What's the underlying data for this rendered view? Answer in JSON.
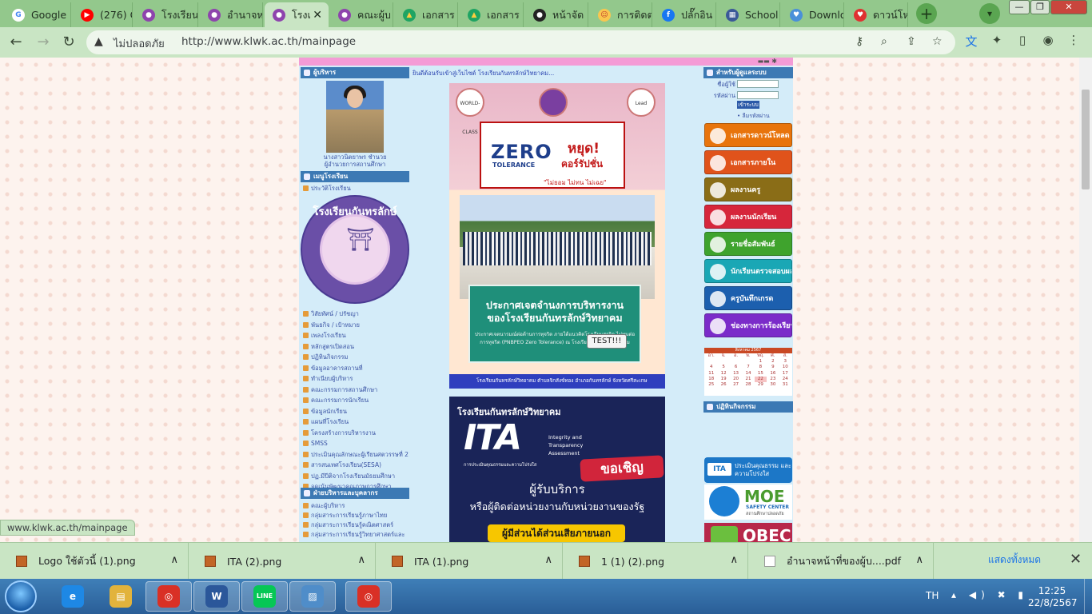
{
  "browser": {
    "tabs": [
      {
        "title": "Google",
        "color": "#ffffff",
        "glyph": "G",
        "glyph_color": "#4285f4"
      },
      {
        "title": "(276) G",
        "color": "#ff0000",
        "glyph": "▶",
        "glyph_color": "#ffffff"
      },
      {
        "title": "โรงเรียน",
        "color": "#8e44ad",
        "glyph": "●",
        "glyph_color": "#ffffff"
      },
      {
        "title": "อำนาจห",
        "color": "#8e44ad",
        "glyph": "●",
        "glyph_color": "#ffffff"
      },
      {
        "title": "โรงเ",
        "color": "#8e44ad",
        "glyph": "●",
        "glyph_color": "#ffffff",
        "active": true
      },
      {
        "title": "คณะผู้บ",
        "color": "#8e44ad",
        "glyph": "●",
        "glyph_color": "#ffffff"
      },
      {
        "title": "เอกสาร",
        "color": "#1fa463",
        "glyph": "▲",
        "glyph_color": "#ffcd40"
      },
      {
        "title": "เอกสาร",
        "color": "#1fa463",
        "glyph": "▲",
        "glyph_color": "#ffcd40"
      },
      {
        "title": "หน้าจัด",
        "color": "#222222",
        "glyph": "●",
        "glyph_color": "#ffffff"
      },
      {
        "title": "การติดต่",
        "color": "#f9c74f",
        "glyph": "☺",
        "glyph_color": "#c0392b"
      },
      {
        "title": "ปลั๊กอิน",
        "color": "#1877f2",
        "glyph": "f",
        "glyph_color": "#ffffff"
      },
      {
        "title": "School",
        "color": "#3b5998",
        "glyph": "▦",
        "glyph_color": "#ffffff"
      },
      {
        "title": "Downlo",
        "color": "#4a90d9",
        "glyph": "♥",
        "glyph_color": "#ffffff"
      },
      {
        "title": "ดาวน์โห",
        "color": "#e03131",
        "glyph": "♥",
        "glyph_color": "#ffffff"
      }
    ],
    "tab_close_glyph": "✕",
    "new_tab_glyph": "+",
    "tab_list_glyph": "▾",
    "window_buttons": {
      "minimize": "—",
      "restore": "❐",
      "close": "✕"
    },
    "security_label": "ไม่ปลอดภัย",
    "url": "http://www.klwk.ac.th/mainpage",
    "icons": {
      "back": "←",
      "forward": "→",
      "reload": "↻",
      "warning": "▲",
      "key": "⚷",
      "zoom": "⌕",
      "share": "⇪",
      "star": "☆",
      "translate": "文",
      "extensions": "✦",
      "sidepanel": "▯",
      "profile": "◉",
      "menu": "⋮"
    }
  },
  "site": {
    "marquee": "ยินดีต้อนรับเข้าสู่เว็บไซต์ โรงเรียนกันทรลักษ์วิทยาคม...",
    "admin": {
      "header": "ผู้บริหาร",
      "name": "นางสาวนิตยาพร ชำนวย",
      "position": "ผู้อำนวยการสถานศึกษา"
    },
    "menu_header": "เมนูโรงเรียน",
    "menu_top_item": "ประวัติโรงเรียน",
    "school_logo_text": "โรงเรียนกันทรลักษ์วิทยาคม",
    "menu_items": [
      "วิสัยทัศน์ / ปรัชญา",
      "พันธกิจ / เป้าหมาย",
      "เพลงโรงเรียน",
      "หลักสูตรเปิดสอน",
      "ปฏิทินกิจกรรม",
      "ข้อมูลอาคารสถานที่",
      "ทำเนียบผู้บริหาร",
      "คณะกรรมการสถานศึกษา",
      "คณะกรรมการนักเรียน",
      "ข้อมูลนักเรียน",
      "แผนที่โรงเรียน",
      "โครงสร้างการบริหารงาน",
      "SMSS",
      "ประเมินคุณลักษณะผู้เรียนศตวรรษที่ 21",
      "สารสนเทศโรงเรียน(SESA)",
      "ปฏ.มีปีติจากโรงเรียนมัธยมศึกษา",
      "จุดเน้นพัฒนาคุณภาพการศึกษา"
    ],
    "dept_header": "ฝ่ายบริหารและบุคลากร",
    "dept_items": [
      "คณะผู้บริหาร",
      "กลุ่มสาระการเรียนรู้ภาษาไทย",
      "กลุ่มสาระการเรียนรู้คณิตศาสตร์",
      "กลุ่มสาระการเรียนรู้วิทยาศาสตร์และ"
    ],
    "poster1": {
      "logo_left": "WORLD-CLASS",
      "logo_right": "Lead",
      "zero": "ZERO",
      "tolerance": "TOLERANCE",
      "stop": "หยุด!",
      "corruption": "คอร์รัปชั่น",
      "slogan": "\"ไม่ยอม ไม่ทน ไม่เฉย\"",
      "announce_line1": "ประกาศเจตจำนงการบริหารงาน",
      "announce_line2": "ของโรงเรียนกันทรลักษ์วิทยาคม",
      "announce_body": "ประกาศเจตนารมณ์ต่อต้านการทุจริต ภายใต้แนวคิดโรงเรียนสุจริต ไม่ทนต่อการทุจริต (PNBPEO Zero Tolerance) ณ โรงเรียนกันทรลักษ์วิทยาคม",
      "test_button": "TEST!!!",
      "footer": "โรงเรียนกันทรลักษ์วิทยาคม ตำบลจิกสังข์ทอง อำเภอกันทรลักษ์ จังหวัดศรีสะเกษ"
    },
    "poster2": {
      "school": "โรงเรียนกันทรลักษ์วิทยาคม",
      "ita": "ITA",
      "ita_full": "Integrity and Transparency Assessment",
      "ita_thai": "การประเมินคุณธรรมและความโปร่งใส",
      "invite": "ขอเชิญ",
      "line1": "ผู้รับบริการ",
      "line2": "หรือผู้ติดต่อหน่วยงานกับหน่วยงานของรัฐ",
      "bar": "ผู้มีส่วนได้ส่วนเสียภายนอก"
    },
    "login": {
      "header": "สำหรับผู้ดูแลระบบ",
      "username_label": "ชื่อผู้ใช้",
      "password_label": "รหัสผ่าน",
      "submit": "เข้าระบบ",
      "forgot": "• ลืมรหัสผ่าน"
    },
    "side_buttons": [
      {
        "label": "เอกสารดาวน์โหลด",
        "color": "#e8740c"
      },
      {
        "label": "เอกสารภายใน",
        "color": "#e0531b"
      },
      {
        "label": "ผลงานครู",
        "color": "#8a6d17"
      },
      {
        "label": "ผลงานนักเรียน",
        "color": "#d6263b"
      },
      {
        "label": "รายชื่อสัมพันธ์",
        "color": "#3fa32d"
      },
      {
        "label": "นักเรียนตรวจสอบผลการเรียน",
        "color": "#1aa7b5"
      },
      {
        "label": "ครูบันทึกเกรด",
        "color": "#1c5fae"
      },
      {
        "label": "ช่องทางการร้องเรียน การทุจริตและประพฤติมิชอบ",
        "color": "#7b2bc9"
      }
    ],
    "calendar": {
      "month": "สิงหาคม 2567",
      "weekdays": [
        "อา.",
        "จ.",
        "อ.",
        "พ.",
        "พฤ.",
        "ศ.",
        "ส."
      ],
      "days": [
        "",
        "",
        "",
        "",
        "1",
        "2",
        "3",
        "4",
        "5",
        "6",
        "7",
        "8",
        "9",
        "10",
        "11",
        "12",
        "13",
        "14",
        "15",
        "16",
        "17",
        "18",
        "19",
        "20",
        "21",
        "22",
        "23",
        "24",
        "25",
        "26",
        "27",
        "28",
        "29",
        "30",
        "31"
      ],
      "today": "22"
    },
    "activities_header": "ปฏิทินกิจกรรม",
    "ita_button": {
      "logo": "ITA",
      "text": "ประเมินคุณธรรม และความโปร่งใส"
    },
    "moe": {
      "title": "MOE",
      "sub": "SAFETY CENTER",
      "sub2": "สถานศึกษาปลอดภัย"
    },
    "obec": "OBEC"
  },
  "status_url": "www.klwk.ac.th/mainpage",
  "downloads": {
    "items": [
      {
        "name": "Logo ใช้ตัวนี้ (1).png",
        "type": "png"
      },
      {
        "name": "ITA (2).png",
        "type": "png"
      },
      {
        "name": "ITA (1).png",
        "type": "png"
      },
      {
        "name": "1 (1) (2).png",
        "type": "png"
      },
      {
        "name": "อำนาจหน้าที่ของผู้บ....pdf",
        "type": "pdf"
      }
    ],
    "chevron": "∧",
    "show_all": "แสดงทั้งหมด",
    "close": "✕"
  },
  "taskbar": {
    "apps": [
      {
        "name": "internet-explorer",
        "glyph": "e",
        "color": "#1e88e5"
      },
      {
        "name": "file-explorer",
        "glyph": "▤",
        "color": "#e2b33c"
      },
      {
        "name": "chrome",
        "glyph": "◎",
        "color": "#d93025"
      },
      {
        "name": "word",
        "glyph": "W",
        "color": "#2b579a"
      },
      {
        "name": "line",
        "glyph": "LINE",
        "color": "#06c755"
      },
      {
        "name": "photos",
        "glyph": "▨",
        "color": "#4f8dc9"
      },
      {
        "name": "chrome-2",
        "glyph": "◎",
        "color": "#d93025"
      }
    ],
    "lang": "TH",
    "tray_icons": "▴ ◀) ✖ ▮",
    "time": "12:25",
    "date": "22/8/2567"
  }
}
